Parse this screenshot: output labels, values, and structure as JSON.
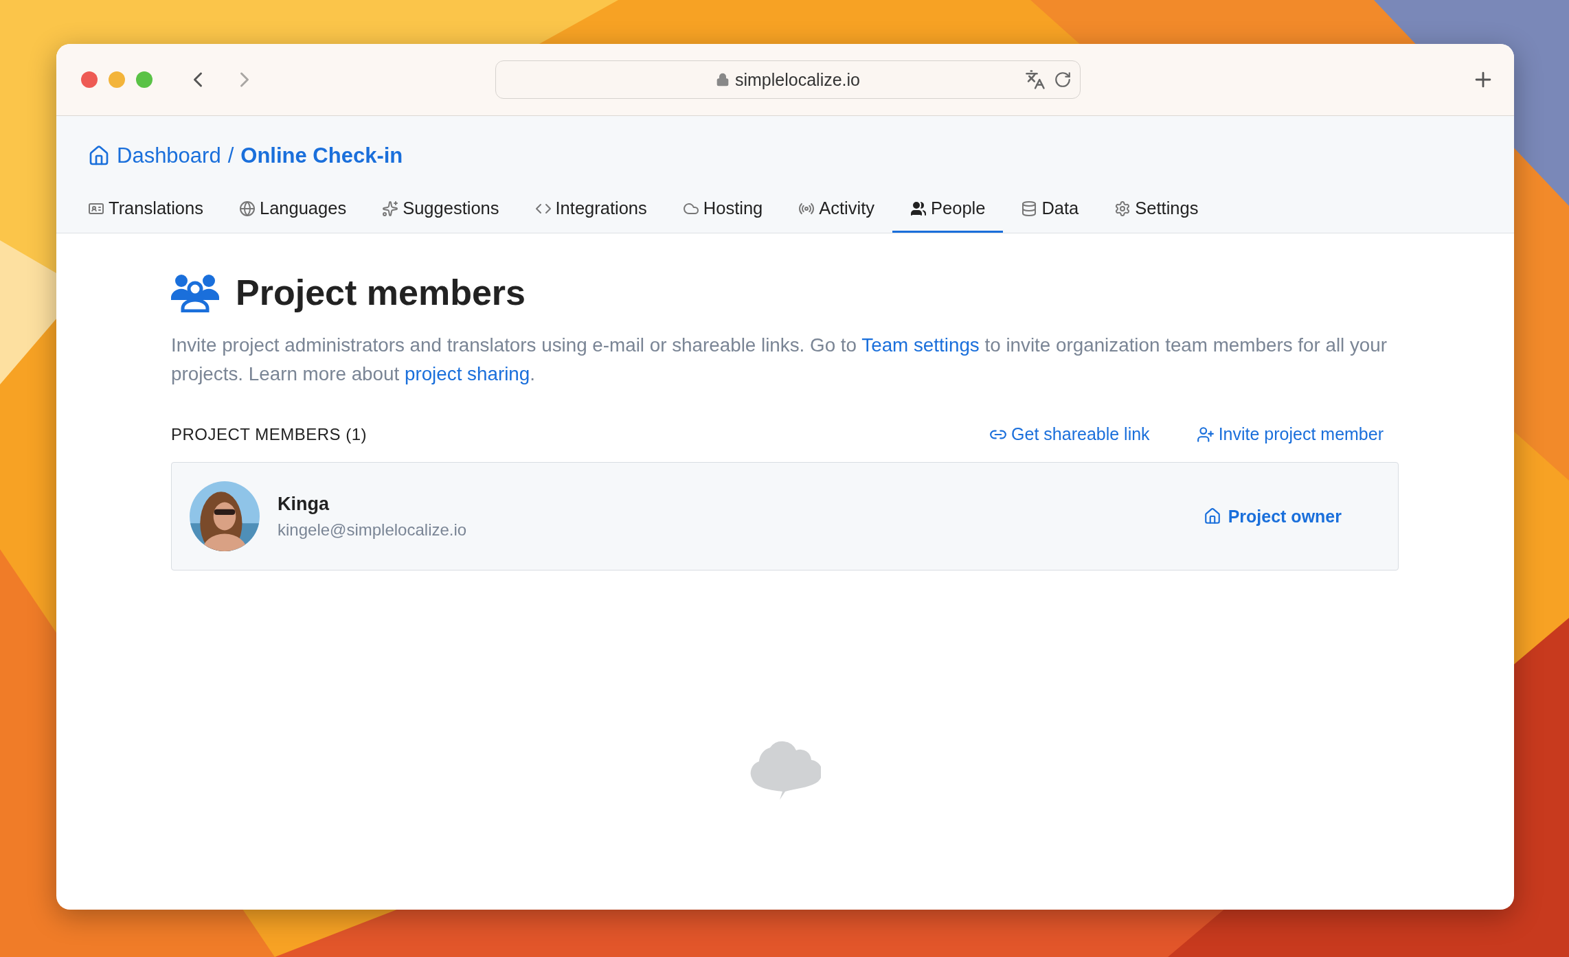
{
  "browser": {
    "url": "simplelocalize.io"
  },
  "breadcrumb": {
    "parent": "Dashboard",
    "separator": "/",
    "current": "Online Check-in"
  },
  "tabs": [
    {
      "label": "Translations",
      "selected": false
    },
    {
      "label": "Languages",
      "selected": false
    },
    {
      "label": "Suggestions",
      "selected": false
    },
    {
      "label": "Integrations",
      "selected": false
    },
    {
      "label": "Hosting",
      "selected": false
    },
    {
      "label": "Activity",
      "selected": false
    },
    {
      "label": "People",
      "selected": true
    },
    {
      "label": "Data",
      "selected": false
    },
    {
      "label": "Settings",
      "selected": false
    }
  ],
  "page": {
    "title": "Project members",
    "description": [
      {
        "kind": "text",
        "text": "Invite project administrators and translators using e-mail or shareable links. Go to "
      },
      {
        "kind": "link",
        "text": "Team settings"
      },
      {
        "kind": "text",
        "text": " to invite organization team members for all your projects. Learn more about "
      },
      {
        "kind": "link",
        "text": "project sharing"
      },
      {
        "kind": "text",
        "text": "."
      }
    ]
  },
  "members_section": {
    "heading": "PROJECT MEMBERS (1)",
    "actions": [
      "Get shareable link",
      "Invite project member"
    ],
    "members": [
      {
        "name": "Kinga",
        "email": "kingele@simplelocalize.io",
        "role": "Project owner"
      }
    ]
  }
}
